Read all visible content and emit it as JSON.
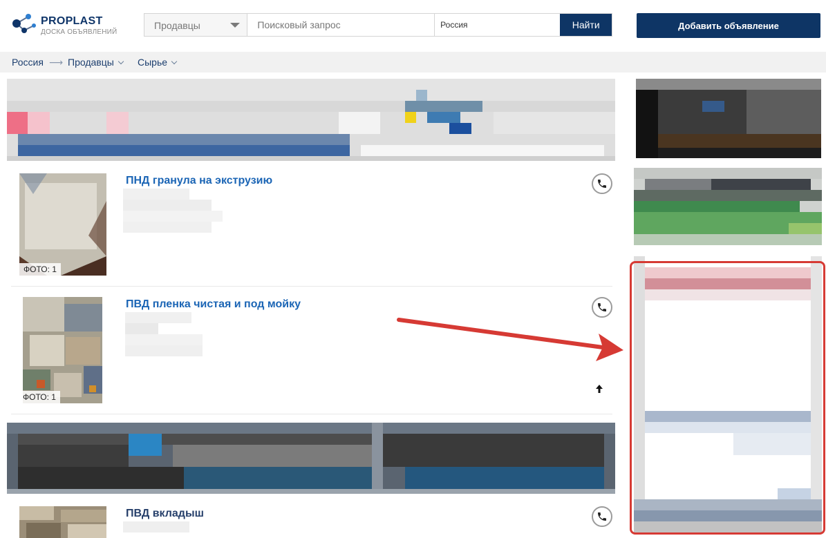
{
  "header": {
    "logo_title": "PROPLAST",
    "logo_subtitle": "ДОСКА ОБЪЯВЛЕНИЙ",
    "category_select": "Продавцы",
    "search_placeholder": "Поисковый запрос",
    "region_value": "Россия",
    "find_button": "Найти",
    "add_button": "Добавить объявление"
  },
  "breadcrumb": {
    "items": [
      {
        "label": "Россия"
      },
      {
        "label": "Продавцы"
      },
      {
        "label": "Сырье"
      }
    ],
    "separator": "⟶"
  },
  "listings": [
    {
      "title": "ПНД гранула на экструзию",
      "photo_label": "ФОТО: 1"
    },
    {
      "title": "ПВД пленка чистая и под мойку",
      "photo_label": "ФОТО: 1"
    },
    {
      "title": "ПВД вкладыш"
    }
  ],
  "colors": {
    "brand_navy": "#0e3565",
    "link_blue": "#1b65b5",
    "annotation_red": "#d63a34"
  }
}
